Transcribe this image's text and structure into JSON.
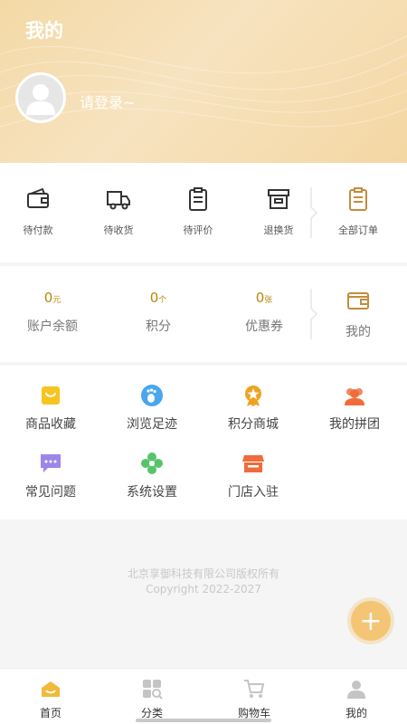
{
  "header": {
    "title": "我的",
    "login_prompt": "请登录~"
  },
  "orders": {
    "items": [
      {
        "label": "待付款",
        "icon": "wallet-icon"
      },
      {
        "label": "待收货",
        "icon": "truck-icon"
      },
      {
        "label": "待评价",
        "icon": "clipboard-icon"
      },
      {
        "label": "退换货",
        "icon": "box-icon"
      }
    ],
    "all_label": "全部订单",
    "all_icon": "orders-clipboard-icon"
  },
  "assets": {
    "items": [
      {
        "value": "0",
        "unit": "元",
        "label": "账户余额"
      },
      {
        "value": "0",
        "unit": "个",
        "label": "积分"
      },
      {
        "value": "0",
        "unit": "张",
        "label": "优惠券"
      }
    ],
    "mine_label": "我的",
    "mine_icon": "wallet-icon"
  },
  "services": {
    "items": [
      {
        "label": "商品收藏",
        "icon": "favorites-bag-icon"
      },
      {
        "label": "浏览足迹",
        "icon": "footprint-icon"
      },
      {
        "label": "积分商城",
        "icon": "medal-icon"
      },
      {
        "label": "我的拼团",
        "icon": "group-icon"
      },
      {
        "label": "常见问题",
        "icon": "chat-icon"
      },
      {
        "label": "系统设置",
        "icon": "flower-icon"
      },
      {
        "label": "门店入驻",
        "icon": "store-icon"
      }
    ]
  },
  "footer": {
    "copyright_line1": "北京享御科技有限公司版权所有",
    "copyright_line2": "Copyright 2022-2027"
  },
  "tabbar": {
    "items": [
      {
        "label": "首页",
        "icon": "home-icon",
        "active": true
      },
      {
        "label": "分类",
        "icon": "category-icon",
        "active": false
      },
      {
        "label": "购物车",
        "icon": "cart-icon",
        "active": false
      },
      {
        "label": "我的",
        "icon": "user-icon",
        "active": false
      }
    ]
  },
  "colors": {
    "accent": "#f3c574",
    "value_gold": "#b8860b",
    "header_bg": "#f4dcae"
  }
}
